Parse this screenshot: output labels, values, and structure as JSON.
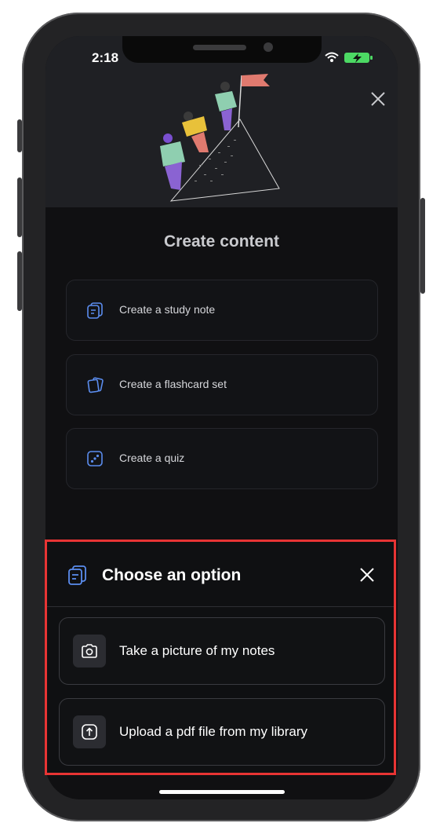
{
  "status_bar": {
    "time": "2:18"
  },
  "page": {
    "title": "Create content"
  },
  "options": [
    {
      "label": "Create a study note",
      "icon": "note-icon"
    },
    {
      "label": "Create a flashcard set",
      "icon": "flashcard-icon"
    },
    {
      "label": "Create a quiz",
      "icon": "quiz-icon"
    }
  ],
  "sheet": {
    "title": "Choose an option",
    "items": [
      {
        "label": "Take a picture of my notes",
        "icon": "camera-icon"
      },
      {
        "label": "Upload a pdf file from my library",
        "icon": "upload-icon"
      }
    ]
  },
  "colors": {
    "accent": "#5b8def",
    "highlight": "#e83434"
  }
}
